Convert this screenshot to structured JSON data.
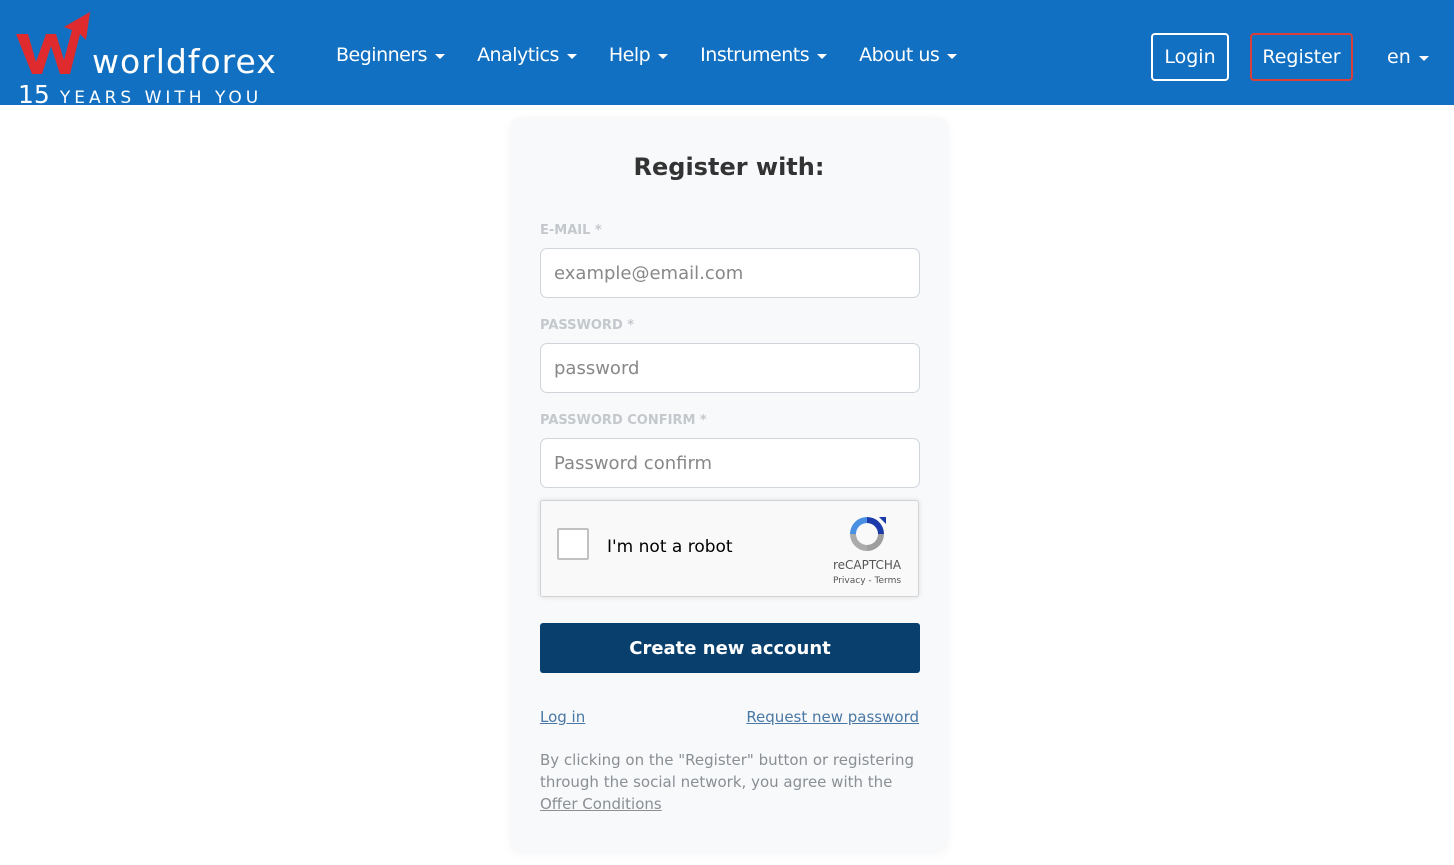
{
  "header": {
    "logo_name": "worldforex",
    "logo_years_number": "15",
    "logo_years_text": "YEARS WITH YOU",
    "nav": [
      {
        "label": "Beginners"
      },
      {
        "label": "Analytics"
      },
      {
        "label": "Help"
      },
      {
        "label": "Instruments"
      },
      {
        "label": "About us"
      }
    ],
    "login_label": "Login",
    "register_label": "Register",
    "language": "en"
  },
  "form": {
    "title": "Register with:",
    "email_label": "E-MAIL *",
    "email_placeholder": "example@email.com",
    "password_label": "PASSWORD *",
    "password_placeholder": "password",
    "password_confirm_label": "PASSWORD CONFIRM *",
    "password_confirm_placeholder": "Password confirm",
    "captcha_text": "I'm not a robot",
    "captcha_brand": "reCAPTCHA",
    "captcha_privacy": "Privacy",
    "captcha_separator": " - ",
    "captcha_terms": "Terms",
    "create_button": "Create new account",
    "login_link": "Log in",
    "request_password_link": "Request new password",
    "terms_text": "By clicking on the \"Register\" button or registering through the social network, you agree with the ",
    "terms_link": "Offer Conditions"
  },
  "colors": {
    "header_bg": "#1170c1",
    "register_border": "#d9403b",
    "logo_red": "#e02b2e",
    "primary_button": "#083f6d"
  }
}
